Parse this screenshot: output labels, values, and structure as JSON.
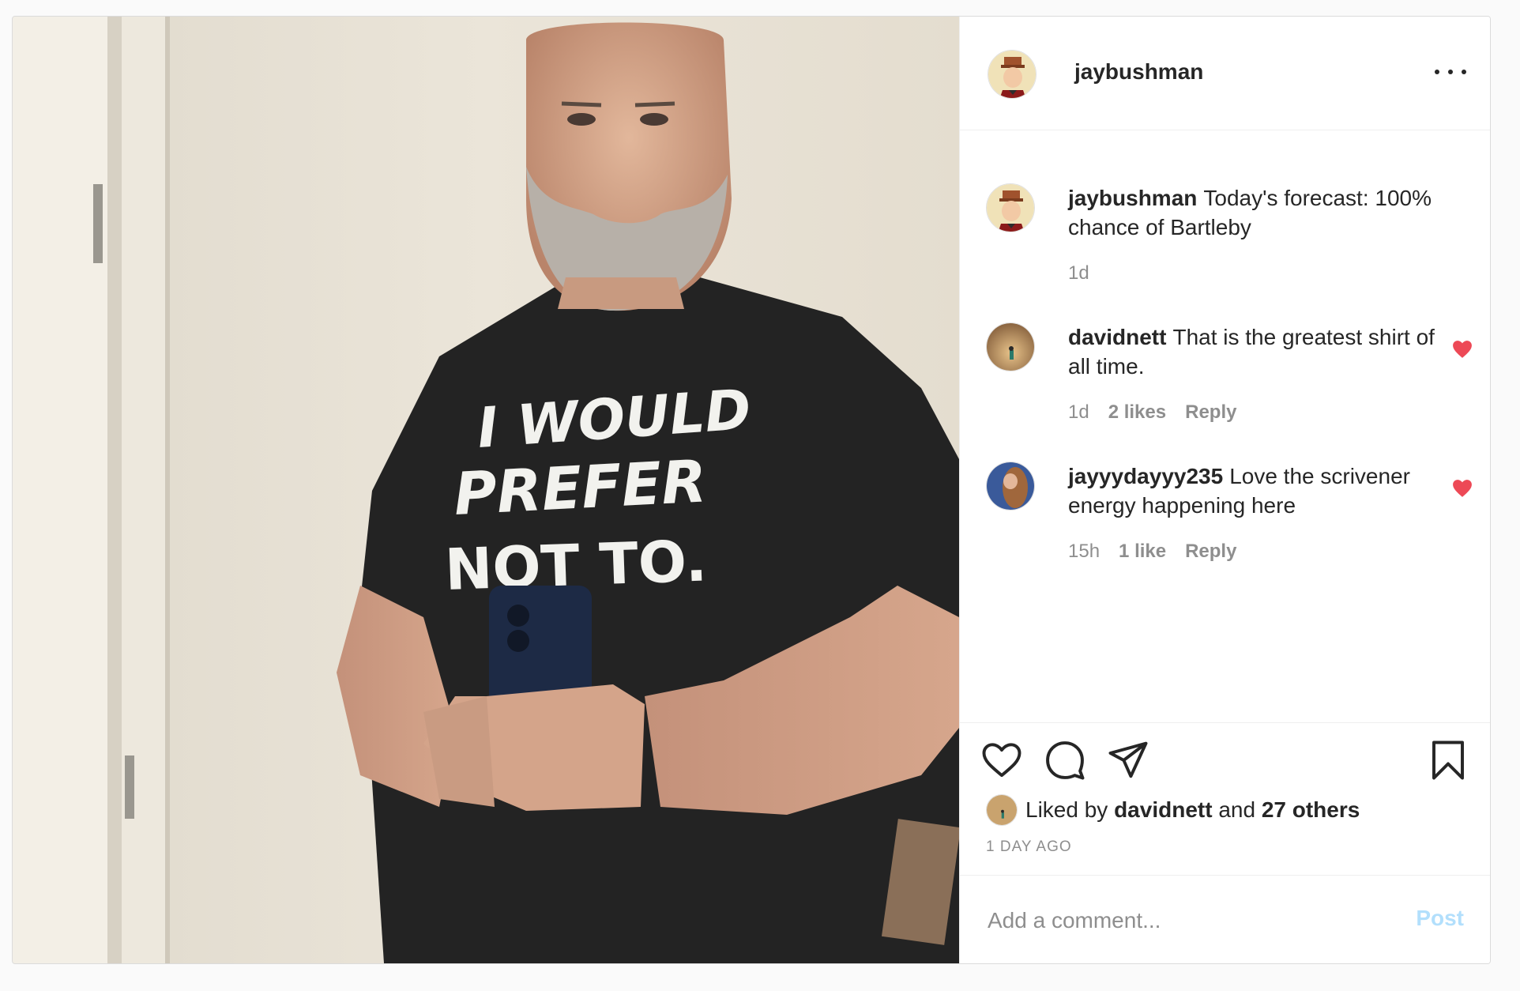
{
  "post": {
    "author": "jaybushman",
    "shirt_text": [
      "I WOULD",
      "PREFER",
      "NOT TO."
    ]
  },
  "caption": {
    "username": "jaybushman",
    "text": "Today's forecast: 100% chance of Bartleby",
    "time": "1d"
  },
  "comments": [
    {
      "username": "davidnett",
      "text": "That is the greatest shirt of all time.",
      "time": "1d",
      "likes": "2 likes",
      "reply": "Reply",
      "liked": true
    },
    {
      "username": "jayyydayyy235",
      "text": "Love the scrivener energy happening here",
      "time": "15h",
      "likes": "1 like",
      "reply": "Reply",
      "liked": true
    }
  ],
  "likes": {
    "prefix": "Liked by ",
    "user": "davidnett",
    "joiner": " and ",
    "others": "27 others"
  },
  "timestamp": "1 DAY AGO",
  "add_comment": {
    "placeholder": "Add a comment...",
    "post_label": "Post"
  },
  "icons": {
    "like": "heart-icon",
    "comment": "comment-icon",
    "share": "paper-plane-icon",
    "save": "bookmark-icon",
    "more": "more-options-icon"
  },
  "colors": {
    "heart_red": "#ed4956",
    "post_button_disabled": "#b2dffc",
    "muted_text": "#8e8e8e",
    "border": "#dbdbdb"
  }
}
